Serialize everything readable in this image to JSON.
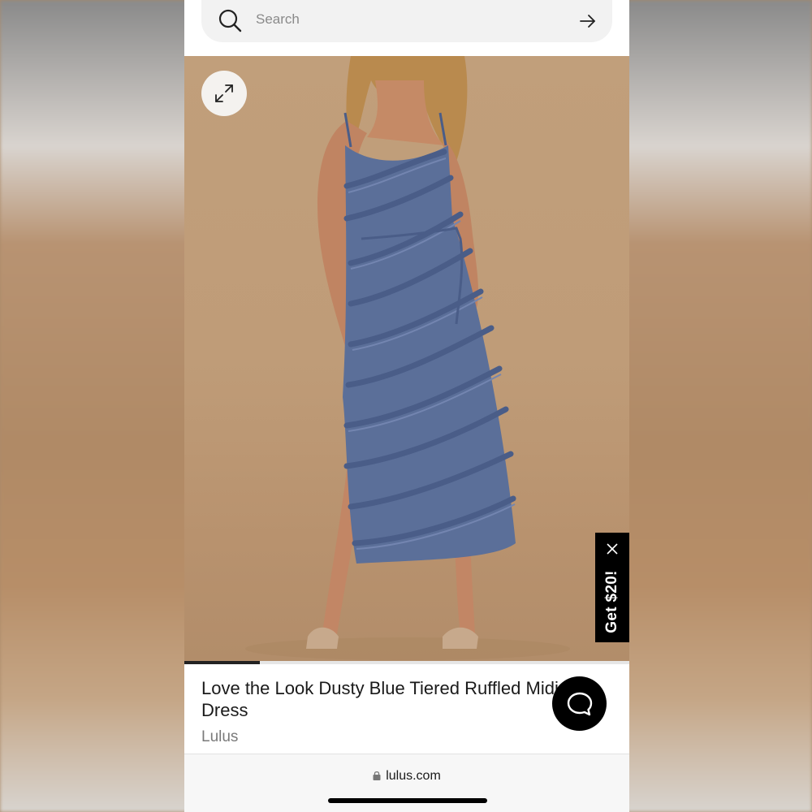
{
  "search": {
    "placeholder": "Search"
  },
  "product": {
    "title": "Love the Look Dusty Blue Tiered Ruffled Midi Dress",
    "brand": "Lulus",
    "gallery_progress": 0.17
  },
  "promo": {
    "label": "Get $20!"
  },
  "browser": {
    "url": "lulus.com"
  },
  "colors": {
    "dress": "#5b6f99",
    "backdrop": "#c19f7b",
    "promo_bg": "#000000"
  },
  "icons": {
    "search": "search-icon",
    "submit": "arrow-right-icon",
    "expand": "expand-icon",
    "close": "close-icon",
    "chat": "chat-bubble-icon",
    "lock": "lock-icon"
  }
}
